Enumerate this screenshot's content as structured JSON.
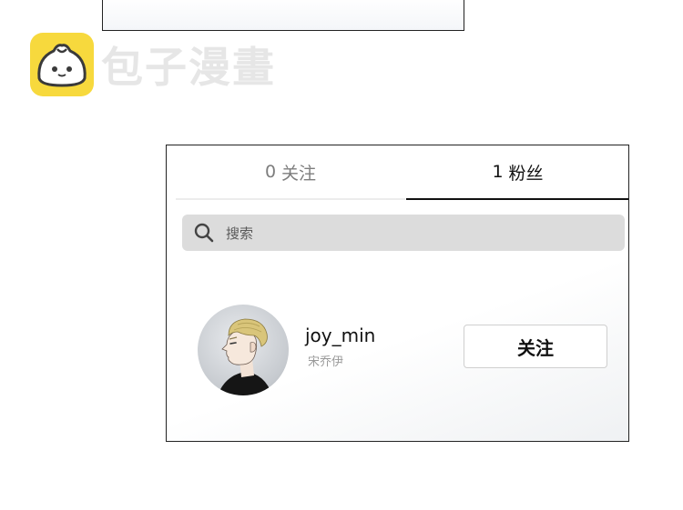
{
  "watermark": {
    "brand_text": "包子漫畫",
    "logo_icon": "bun-mascot-icon",
    "logo_color": "#f7d93d"
  },
  "tabs": {
    "following": {
      "count": "0",
      "label": "关注"
    },
    "followers": {
      "count": "1",
      "label": "粉丝",
      "active": true
    }
  },
  "search": {
    "icon": "search-icon",
    "placeholder": "搜索"
  },
  "users": [
    {
      "username": "joy_min",
      "display_name": "宋乔伊",
      "follow_label": "关注"
    }
  ]
}
